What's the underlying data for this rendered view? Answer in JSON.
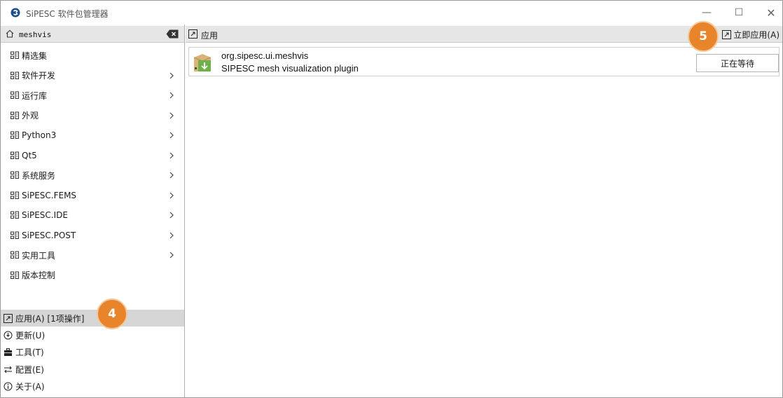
{
  "window": {
    "title": "SiPESC 软件包管理器",
    "minimize": "—",
    "maximize": "☐",
    "close": "✕"
  },
  "search": {
    "value": "meshvis",
    "placeholder": ""
  },
  "categories": [
    {
      "label": "精选集",
      "has_children": false
    },
    {
      "label": "软件开发",
      "has_children": true
    },
    {
      "label": "运行库",
      "has_children": true
    },
    {
      "label": "外观",
      "has_children": true
    },
    {
      "label": "Python3",
      "has_children": true
    },
    {
      "label": "Qt5",
      "has_children": true
    },
    {
      "label": "系统服务",
      "has_children": true
    },
    {
      "label": "SiPESC.FEMS",
      "has_children": true
    },
    {
      "label": "SiPESC.IDE",
      "has_children": true
    },
    {
      "label": "SiPESC.POST",
      "has_children": true
    },
    {
      "label": "实用工具",
      "has_children": true
    },
    {
      "label": "版本控制",
      "has_children": false
    }
  ],
  "bottom_nav": [
    {
      "label": "应用(A) [1项操作]",
      "icon": "apply-icon",
      "active": true
    },
    {
      "label": "更新(U)",
      "icon": "update-icon",
      "active": false
    },
    {
      "label": "工具(T)",
      "icon": "toolbox-icon",
      "active": false
    },
    {
      "label": "配置(E)",
      "icon": "settings-icon",
      "active": false
    },
    {
      "label": "关于(A)",
      "icon": "info-icon",
      "active": false
    }
  ],
  "main": {
    "header_label": "应用",
    "apply_now_label": "立即应用(A)",
    "packages": [
      {
        "name": "org.sipesc.ui.meshvis",
        "description": "SIPESC mesh visualization plugin",
        "status": "正在等待",
        "icon": "package-icon"
      }
    ]
  },
  "annotations": {
    "step_4": "4",
    "step_5": "5",
    "color": "#e8842a"
  }
}
